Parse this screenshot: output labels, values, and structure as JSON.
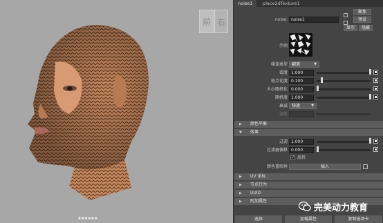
{
  "viewport": {
    "viewcube": {
      "front": "前",
      "right": "右"
    },
    "caption": "■■■■■■"
  },
  "panel": {
    "tabs": [
      {
        "label": "noise1"
      },
      {
        "label": "place2dTexture1"
      }
    ],
    "node_label": "noise:",
    "node_name": "noise1",
    "buttons": {
      "focus": "聚焦",
      "presets": "预设",
      "show": "显示",
      "hide": "隐藏"
    },
    "sample_label": "示例",
    "attributes": {
      "noise_type_label": "噪波类型",
      "noise_type_value": "翻滚",
      "density_label": "密度",
      "density_value": "1.000",
      "spottyness_label": "斑点化度",
      "spottyness_value": "0.100",
      "size_rand_label": "大小随机化",
      "size_rand_value": "0.000",
      "randomness_label": "随机度",
      "randomness_value": "1.000",
      "falloff_label": "衰减",
      "falloff_value": "快速",
      "num_waves_label": "波数"
    },
    "sections": {
      "color_balance": "颜色平衡",
      "effects": "效果",
      "uv_coords": "UV 坐标",
      "node_behavior": "节点行为",
      "uuid": "UUID",
      "extra_attrs": "附加属性"
    },
    "effects": {
      "filter_label": "过滤",
      "filter_value": "1.000",
      "filter_offset_label": "过滤器偏移",
      "filter_offset_value": "0.000",
      "invert_label": "反转",
      "color_remap_label": "颜色重映射",
      "insert_label": "插入"
    },
    "bottom": {
      "select": "选择",
      "load_attrs": "加载属性",
      "copy_tab": "复制选项卡"
    }
  },
  "watermark": {
    "text": "完美动力教育"
  }
}
